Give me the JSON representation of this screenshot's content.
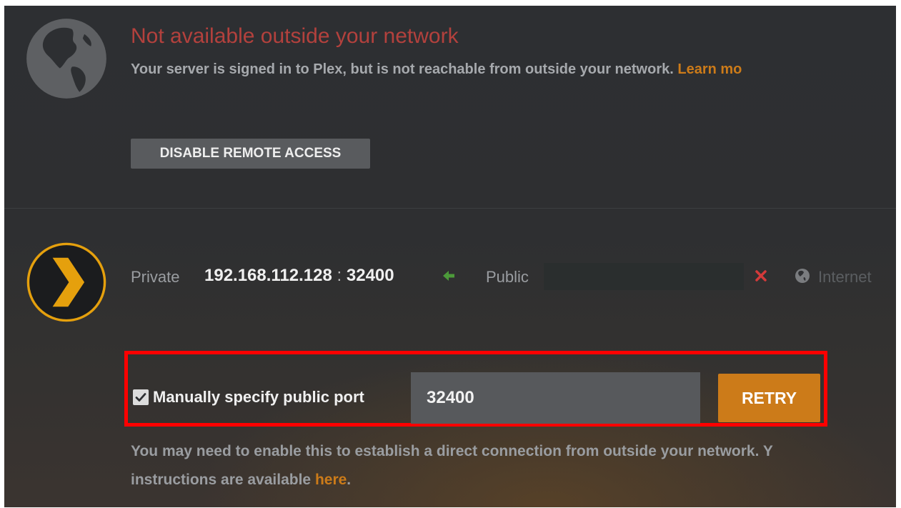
{
  "remote_access": {
    "status_title": "Not available outside your network",
    "status_description": "Your server is signed in to Plex, but is not reachable from outside your network.",
    "learn_more_link": "Learn mo",
    "disable_button": "DISABLE REMOTE ACCESS"
  },
  "connection": {
    "private_label": "Private",
    "private_ip": "192.168.112.128",
    "separator": ":",
    "private_port": "32400",
    "public_label": "Public",
    "public_value": "",
    "internet_label": "Internet",
    "icons": {
      "arrow": "arrow-left-icon",
      "status": "x-icon",
      "internet": "globe-icon"
    }
  },
  "manual_port": {
    "checked": true,
    "checkbox_label": "Manually specify public port",
    "port_value": "32400",
    "retry_button": "RETRY"
  },
  "help": {
    "line1": "You may need to enable this to establish a direct connection from outside your network. Y",
    "line2_prefix": "instructions are available ",
    "line2_link": "here",
    "line2_suffix": "."
  },
  "colors": {
    "accent": "#cc7b19",
    "error": "#b3413d",
    "success": "#4c9a3a",
    "highlight": "#ff0000"
  }
}
